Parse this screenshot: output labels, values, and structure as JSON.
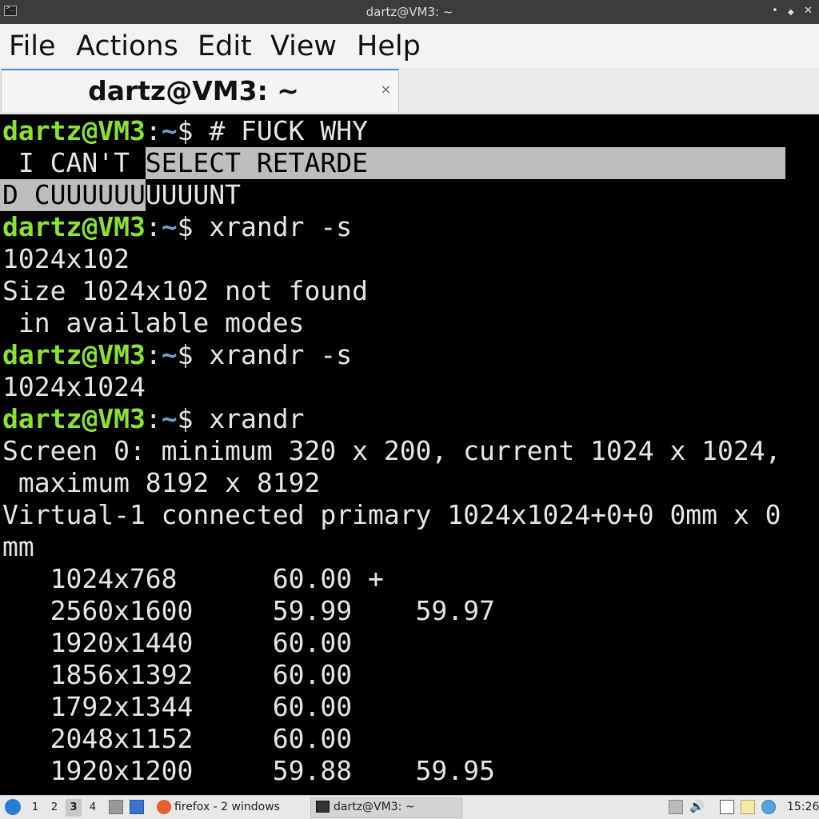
{
  "window": {
    "title": "dartz@VM3: ~",
    "buttons": {
      "minimize": "•",
      "maximize": "◆",
      "close": "✕"
    }
  },
  "menu": [
    "File",
    "Actions",
    "Edit",
    "View",
    "Help"
  ],
  "tab": {
    "label": "dartz@VM3: ~",
    "close": "×"
  },
  "terminal": {
    "prompt_user": "dartz@VM3",
    "prompt_sep": ":",
    "prompt_path": "~",
    "prompt_symbol": "$ ",
    "lines": [
      {
        "type": "prompt",
        "cmd": "# FUCK WHY"
      },
      {
        "type": "selection-start",
        "plain": " I CAN'T ",
        "selected": "SELECT RETARDE"
      },
      {
        "type": "selection-end",
        "selected": "D CUUUUUU",
        "plain": "UUUUNT"
      },
      {
        "type": "prompt",
        "cmd": "xrandr -s"
      },
      {
        "type": "output",
        "text": "1024x102"
      },
      {
        "type": "output",
        "text": "Size 1024x102 not found"
      },
      {
        "type": "output",
        "text": " in available modes"
      },
      {
        "type": "prompt",
        "cmd": "xrandr -s"
      },
      {
        "type": "output",
        "text": "1024x1024"
      },
      {
        "type": "prompt",
        "cmd": "xrandr"
      },
      {
        "type": "output",
        "text": "Screen 0: minimum 320 x 200, current 1024 x 1024,"
      },
      {
        "type": "output",
        "text": " maximum 8192 x 8192"
      },
      {
        "type": "output",
        "text": "Virtual-1 connected primary 1024x1024+0+0 0mm x 0"
      },
      {
        "type": "output",
        "text": "mm"
      },
      {
        "type": "output",
        "text": "   1024x768      60.00 +"
      },
      {
        "type": "output",
        "text": "   2560x1600     59.99    59.97"
      },
      {
        "type": "output",
        "text": "   1920x1440     60.00"
      },
      {
        "type": "output",
        "text": "   1856x1392     60.00"
      },
      {
        "type": "output",
        "text": "   1792x1344     60.00"
      },
      {
        "type": "output",
        "text": "   2048x1152     60.00"
      },
      {
        "type": "output",
        "text": "   1920x1200     59.88    59.95"
      }
    ]
  },
  "taskbar": {
    "workspaces": [
      "1",
      "2",
      "3",
      "4"
    ],
    "active_workspace": "3",
    "tasks": [
      {
        "label": "firefox - 2 windows",
        "icon": "firefox-icon"
      },
      {
        "label": "dartz@VM3: ~",
        "icon": "terminal-icon"
      }
    ],
    "clock": "15:26"
  },
  "colors": {
    "prompt_user": "#8ae234",
    "prompt_path": "#729fcf",
    "terminal_bg": "#000000",
    "terminal_fg": "#e6e6e6",
    "selection_bg": "#bdbdbd"
  }
}
